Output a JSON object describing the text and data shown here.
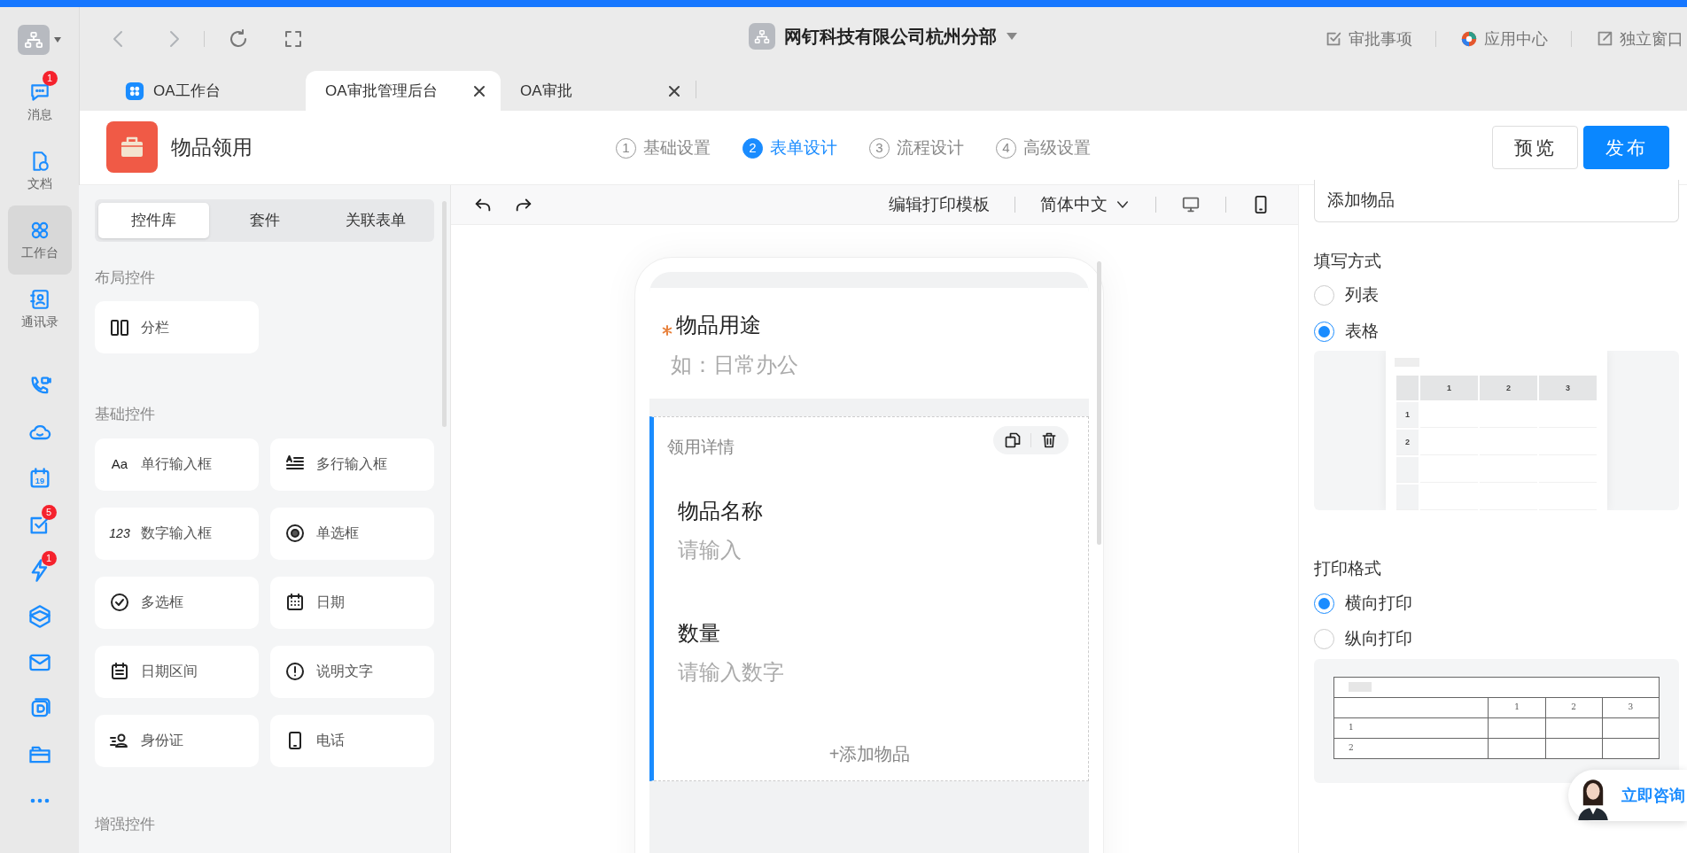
{
  "rail": {
    "items": [
      {
        "kind": "message",
        "label": "消息",
        "badge": "1",
        "selected": false
      },
      {
        "kind": "doc",
        "label": "文档",
        "selected": false
      },
      {
        "kind": "workbench",
        "label": "工作台",
        "selected": true
      },
      {
        "kind": "contacts",
        "label": "通讯录",
        "selected": false
      }
    ],
    "icons": [
      {
        "kind": "call"
      },
      {
        "kind": "cloud"
      },
      {
        "kind": "calendar",
        "text": "19"
      },
      {
        "kind": "todo",
        "badge": "5"
      },
      {
        "kind": "flash",
        "badge": "1"
      },
      {
        "kind": "cube"
      },
      {
        "kind": "mail"
      },
      {
        "kind": "ding"
      },
      {
        "kind": "folder"
      },
      {
        "kind": "more"
      }
    ]
  },
  "header": {
    "org": "网钉科技有限公司杭州分部",
    "links": [
      {
        "kind": "approval",
        "label": "审批事项"
      },
      {
        "kind": "apps",
        "label": "应用中心"
      },
      {
        "kind": "window",
        "label": "独立窗口"
      }
    ]
  },
  "tabs": [
    {
      "label": "OA工作台",
      "selected": false
    },
    {
      "label": "OA审批管理后台",
      "selected": true,
      "closable": true
    },
    {
      "label": "OA审批",
      "selected": false,
      "closable": true
    }
  ],
  "app": {
    "title": "物品领用",
    "steps": [
      {
        "number": "1",
        "label": "基础设置",
        "selected": false
      },
      {
        "number": "2",
        "label": "表单设计",
        "selected": true
      },
      {
        "number": "3",
        "label": "流程设计",
        "selected": false
      },
      {
        "number": "4",
        "label": "高级设置",
        "selected": false
      }
    ],
    "buttons": [
      {
        "label": "预览",
        "primary": false
      },
      {
        "label": "发布",
        "primary": true
      }
    ]
  },
  "palette": {
    "tabs": [
      {
        "label": "控件库",
        "selected": true
      },
      {
        "label": "套件",
        "selected": false
      },
      {
        "label": "关联表单",
        "selected": false
      }
    ],
    "groups": [
      {
        "title": "布局控件",
        "items": [
          {
            "kind": "columns",
            "label": "分栏"
          }
        ]
      },
      {
        "title": "基础控件",
        "items": [
          {
            "kind": "text",
            "glyph": "Aa",
            "label": "单行输入框"
          },
          {
            "kind": "textarea",
            "label": "多行输入框"
          },
          {
            "kind": "number",
            "glyph": "123",
            "label": "数字输入框"
          },
          {
            "kind": "radio",
            "label": "单选框"
          },
          {
            "kind": "checkbox",
            "label": "多选框"
          },
          {
            "kind": "date",
            "label": "日期"
          },
          {
            "kind": "daterange",
            "label": "日期区间"
          },
          {
            "kind": "info",
            "label": "说明文字"
          },
          {
            "kind": "idcard",
            "label": "身份证"
          },
          {
            "kind": "phone",
            "label": "电话"
          }
        ]
      },
      {
        "title": "增强控件"
      }
    ]
  },
  "toolbar": {
    "print_template": "编辑打印模板",
    "language": "简体中文"
  },
  "form": {
    "fields": [
      {
        "label": "物品用途",
        "required": true,
        "placeholder": "如：日常办公"
      }
    ],
    "detail": {
      "title": "领用详情",
      "selected": true,
      "fields": [
        {
          "label": "物品名称",
          "placeholder": "请输入"
        },
        {
          "label": "数量",
          "placeholder": "请输入数字"
        }
      ],
      "add_button": "+添加物品"
    }
  },
  "settings": {
    "button_text": "添加物品",
    "fill_mode": {
      "title": "填写方式",
      "options": [
        {
          "label": "列表",
          "selected": false
        },
        {
          "label": "表格",
          "selected": true
        }
      ],
      "preview": {
        "columns": [
          "1",
          "2",
          "3"
        ],
        "rows": [
          "1",
          "2"
        ]
      }
    },
    "print_format": {
      "title": "打印格式",
      "options": [
        {
          "label": "横向打印",
          "selected": true
        },
        {
          "label": "纵向打印",
          "selected": false
        }
      ],
      "preview": {
        "columns": [
          "1",
          "2",
          "3"
        ],
        "rows": [
          "1",
          "2"
        ]
      }
    }
  },
  "consult": {
    "label": "立即咨询"
  }
}
